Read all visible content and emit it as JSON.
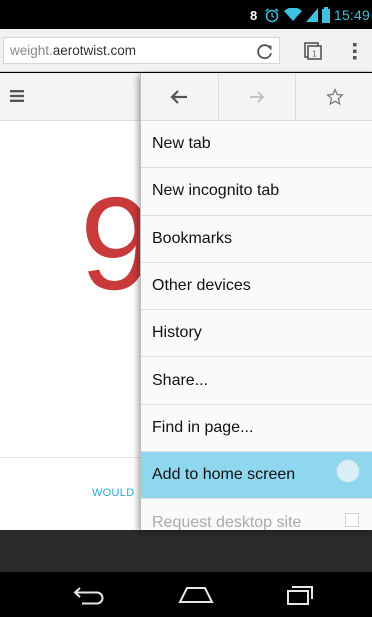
{
  "status_bar": {
    "time": "15:49",
    "icons": [
      "notification-8-icon",
      "alarm-icon",
      "wifi-icon",
      "signal-icon",
      "battery-icon"
    ]
  },
  "address_bar": {
    "url_prefix": "weight.",
    "url_host": "aerotwist.com",
    "icons": [
      "reload-icon",
      "tabs-icon",
      "overflow-menu-icon"
    ]
  },
  "page": {
    "big_digit": "9",
    "footer_text": "WOULD",
    "accent_red": "#c93a3a",
    "accent_blue": "#28a9d8"
  },
  "menu": {
    "nav_icons": [
      "back-arrow-icon",
      "forward-arrow-icon",
      "bookmark-star-icon"
    ],
    "items": [
      {
        "label": "New tab"
      },
      {
        "label": "New incognito tab"
      },
      {
        "label": "Bookmarks"
      },
      {
        "label": "Other devices"
      },
      {
        "label": "History"
      },
      {
        "label": "Share..."
      },
      {
        "label": "Find in page..."
      },
      {
        "label": "Add to home screen"
      },
      {
        "label": "Request desktop site"
      }
    ],
    "highlight_color": "#8fd6ef"
  },
  "nav_bar": {
    "icons": [
      "back-icon",
      "home-icon",
      "recent-apps-icon"
    ]
  }
}
